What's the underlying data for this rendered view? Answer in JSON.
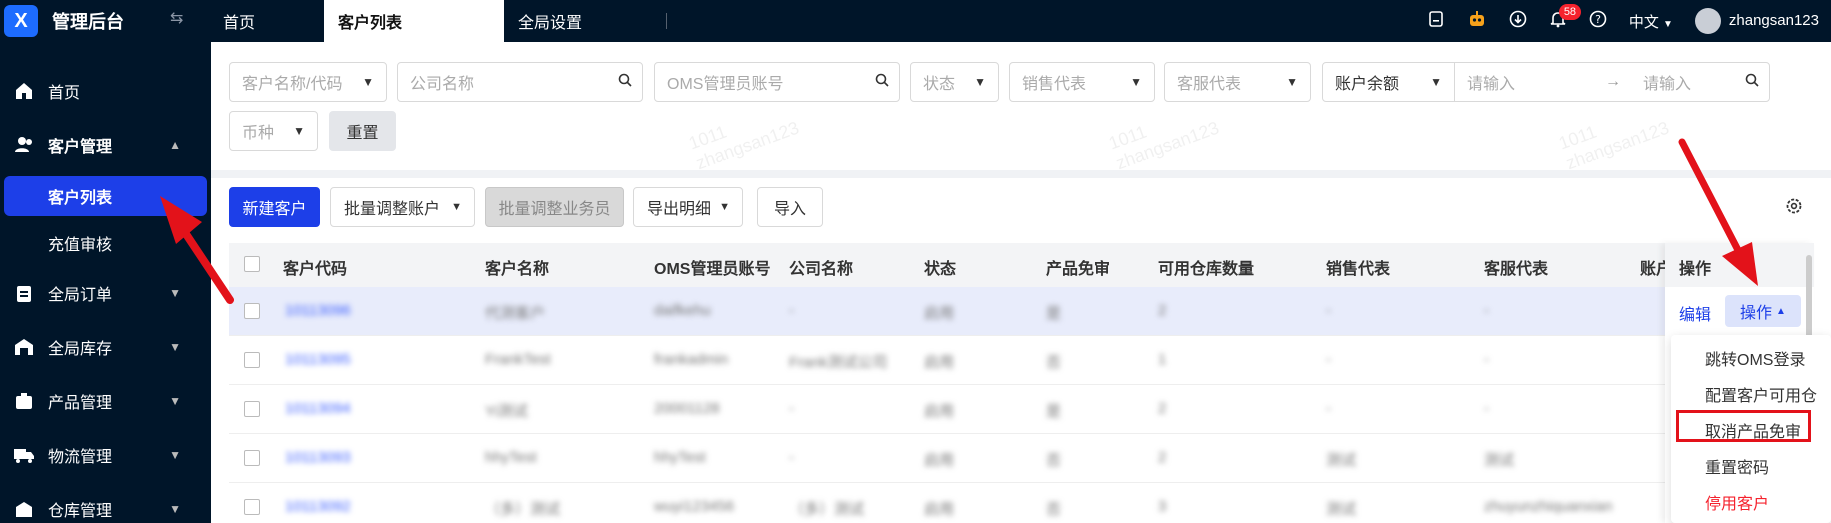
{
  "app": {
    "title": "管理后台",
    "logo_letter": "X"
  },
  "sidebar": {
    "items": [
      {
        "label": "首页",
        "icon": "home-icon"
      },
      {
        "label": "客户管理",
        "icon": "users-icon",
        "open": true,
        "children": [
          {
            "label": "客户列表",
            "active": true
          },
          {
            "label": "充值审核"
          }
        ]
      },
      {
        "label": "全局订单",
        "icon": "clipboard-icon"
      },
      {
        "label": "全局库存",
        "icon": "warehouse-icon"
      },
      {
        "label": "产品管理",
        "icon": "box-icon"
      },
      {
        "label": "物流管理",
        "icon": "truck-icon"
      },
      {
        "label": "仓库管理",
        "icon": "building-icon"
      }
    ]
  },
  "topbar": {
    "tabs": [
      {
        "label": "首页"
      },
      {
        "label": "客户列表",
        "active": true
      },
      {
        "label": "全局设置"
      }
    ],
    "notifications_count": "58",
    "language": "中文",
    "username": "zhangsan123"
  },
  "filters": {
    "customer_code": {
      "placeholder": "客户名称/代码"
    },
    "company_name": {
      "placeholder": "公司名称"
    },
    "oms_admin": {
      "placeholder": "OMS管理员账号"
    },
    "status": {
      "placeholder": "状态"
    },
    "sales_rep": {
      "placeholder": "销售代表"
    },
    "cs_rep": {
      "placeholder": "客服代表"
    },
    "balance_type": {
      "value": "账户余额"
    },
    "balance_min": {
      "placeholder": "请输入"
    },
    "range_arrow": "→",
    "balance_max": {
      "placeholder": "请输入"
    },
    "currency": {
      "placeholder": "币种"
    },
    "reset_label": "重置"
  },
  "toolbar": {
    "new_customer": "新建客户",
    "batch_adjust_account": "批量调整账户",
    "batch_adjust_staff": "批量调整业务员",
    "export_detail": "导出明细",
    "import": "导入"
  },
  "table": {
    "columns": [
      "客户代码",
      "客户名称",
      "OMS管理员账号",
      "公司名称",
      "状态",
      "产品免审",
      "可用仓库数量",
      "销售代表",
      "客服代表",
      "账户"
    ],
    "rows": [
      {
        "code": "10113096",
        "name": "代测客户",
        "oms": "daifkehu",
        "company": "-",
        "status": "启用",
        "review": "是",
        "warehouses": "2",
        "sales": "-",
        "cs": "-"
      },
      {
        "code": "10113095",
        "name": "FrankTest",
        "oms": "frankadmin",
        "company": "Frank测试公司",
        "status": "启用",
        "review": "否",
        "warehouses": "1",
        "sales": "-",
        "cs": "-"
      },
      {
        "code": "10113094",
        "name": "Yi测试",
        "oms": "20001128",
        "company": "-",
        "status": "启用",
        "review": "是",
        "warehouses": "2",
        "sales": "-",
        "cs": "-"
      },
      {
        "code": "10113093",
        "name": "hhyTest",
        "oms": "hhyTest",
        "company": "-",
        "status": "启用",
        "review": "否",
        "warehouses": "2",
        "sales": "测试",
        "cs": "测试"
      },
      {
        "code": "10113092",
        "name": "（多）测试",
        "oms": "wuyi123456",
        "company": "（多）测试",
        "status": "启用",
        "review": "否",
        "warehouses": "3",
        "sales": "测试",
        "cs": "zhuyunzhiquanxian"
      }
    ]
  },
  "operations": {
    "header": "操作",
    "edit": "编辑",
    "edit_partial": "编",
    "ops_button": "操作",
    "menu": [
      "跳转OMS登录",
      "配置客户可用仓",
      "取消产品免审",
      "重置密码",
      "停用客户"
    ]
  },
  "watermark": {
    "line1": "1011",
    "line2": "zhangsan123"
  }
}
